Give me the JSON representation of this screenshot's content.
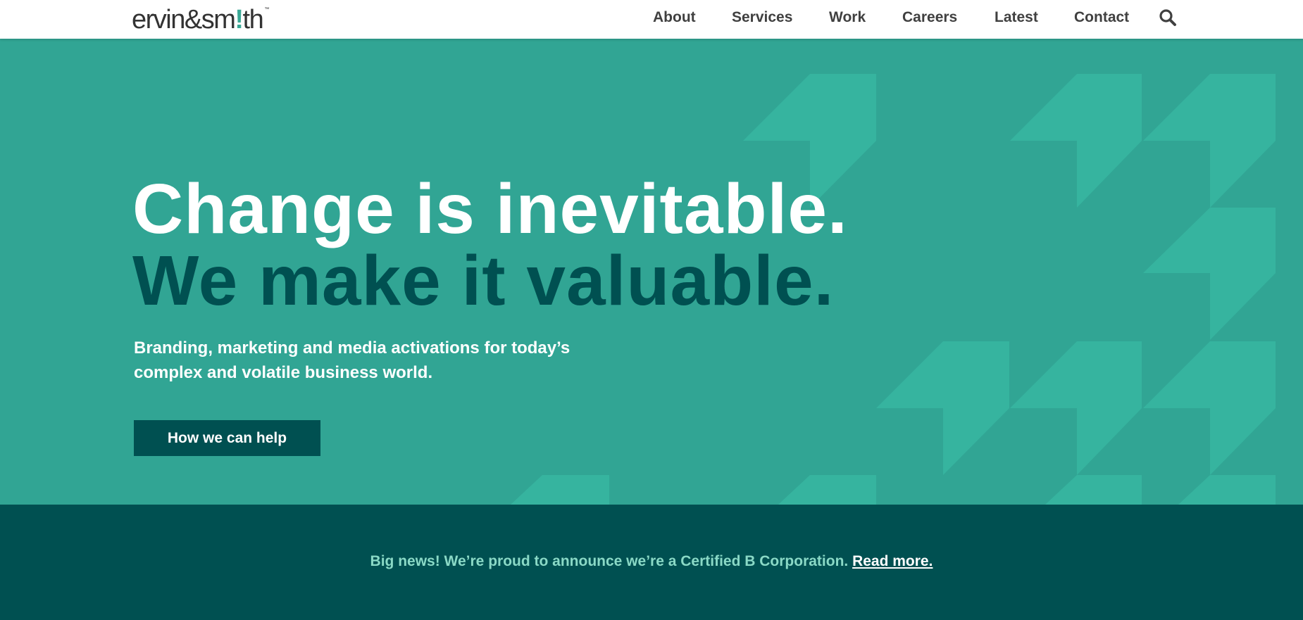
{
  "header": {
    "logo": {
      "part1": "ervin",
      "amp": "&",
      "part2": "sm",
      "bang": "!",
      "part3": "th",
      "tm": "™"
    },
    "nav": [
      {
        "label": "About"
      },
      {
        "label": "Services"
      },
      {
        "label": "Work"
      },
      {
        "label": "Careers"
      },
      {
        "label": "Latest"
      },
      {
        "label": "Contact"
      }
    ],
    "search_icon": "search-icon"
  },
  "hero": {
    "headline_primary": "Change is inevitable.",
    "headline_secondary": "We make it valuable.",
    "subtext_line1": "Branding, marketing and media activations for today’s",
    "subtext_line2": "complex and volatile business world.",
    "cta_label": "How we can help",
    "colors": {
      "background": "#31a594",
      "pattern": "#36b49f",
      "secondary_text": "#005051"
    }
  },
  "banner": {
    "text": "Big news! We’re proud to announce we’re a Certified B Corporation.",
    "link_label": "Read more.",
    "colors": {
      "background": "#005051",
      "text": "#8ad9c6"
    }
  }
}
